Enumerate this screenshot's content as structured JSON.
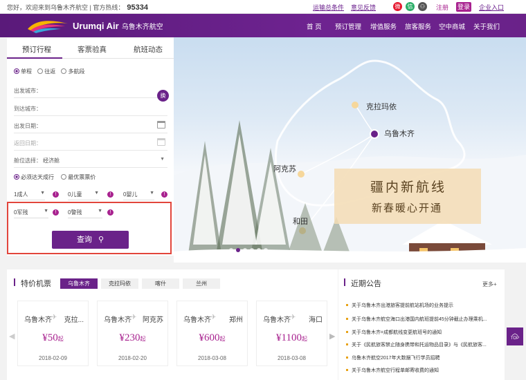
{
  "topbar": {
    "welcome": "您好，欢迎来到乌鲁木齐航空 | 官方热线：",
    "hotline": "95334",
    "links": [
      "运输总条件",
      "意见反馈",
      "注册",
      "登录",
      "企业入口"
    ],
    "icons": [
      "weibo-icon",
      "wechat-icon",
      "user-icon"
    ]
  },
  "nav": {
    "logo_en": "Urumqi Air",
    "logo_cn": "乌鲁木齐航空",
    "items": [
      "首 页",
      "预订管理",
      "增值服务",
      "旅客服务",
      "空中商城",
      "关于我们"
    ]
  },
  "booking": {
    "tabs": [
      "预订行程",
      "客票验真",
      "航班动态"
    ],
    "trip_types": [
      "单程",
      "往返",
      "多航段"
    ],
    "selected_trip": "单程",
    "departure_label": "出发城市：",
    "arrival_label": "到达城市：",
    "depart_date_label": "出发日期：",
    "return_date_label": "返回日期：",
    "cabin_label": "舱位选择：",
    "cabin_value": "经济舱",
    "swap_label": "换",
    "options": [
      "必须达天成行",
      "最优票票价"
    ],
    "pax": [
      "1成人",
      "0儿童",
      "0婴儿"
    ],
    "special": [
      "0军残",
      "0警残"
    ],
    "search_label": "查询"
  },
  "banner": {
    "cities": [
      "克拉玛依",
      "乌鲁木齐",
      "阿克苏",
      "和田"
    ],
    "headline": "疆内新航线",
    "subline": "新春暖心开通",
    "slide_count": 6,
    "active_slide": 1
  },
  "specials": {
    "title": "特价机票",
    "city_tabs": [
      "乌鲁木齐",
      "克拉玛依",
      "喀什",
      "兰州"
    ],
    "active_tab": "乌鲁木齐",
    "cards": [
      {
        "from": "乌鲁木齐",
        "to": "克拉...",
        "price": "50",
        "unit": "起",
        "date": "2018-02-09"
      },
      {
        "from": "乌鲁木齐",
        "to": "阿克苏",
        "price": "230",
        "unit": "起",
        "date": "2018-02-20"
      },
      {
        "from": "乌鲁木齐",
        "to": "郑州",
        "price": "600",
        "unit": "起",
        "date": "2018-03-08"
      },
      {
        "from": "乌鲁木齐",
        "to": "海口",
        "price": "1100",
        "unit": "起",
        "date": "2018-03-08"
      }
    ]
  },
  "notices": {
    "title": "近期公告",
    "more": "更多+",
    "items": [
      "关于乌鲁木齐出港旅客提前航站机场的业务提示",
      "关于乌鲁木齐航空海口出港国内航班提前45分钟截止办理乘机...",
      "关于乌鲁木齐=成都航线变更航班号的通知",
      "关于《民航旅客禁止随身携带和托运物品目录》与《民航旅客...",
      "乌鲁木齐航空2017年大数据飞行学员招聘",
      "关于乌鲁木齐航空行程单邮寄收费的通知"
    ]
  },
  "scroll_top": "TOP",
  "colors": {
    "brand": "#6a2289",
    "accent": "#a8228f",
    "alert_box": "#e2453b"
  }
}
